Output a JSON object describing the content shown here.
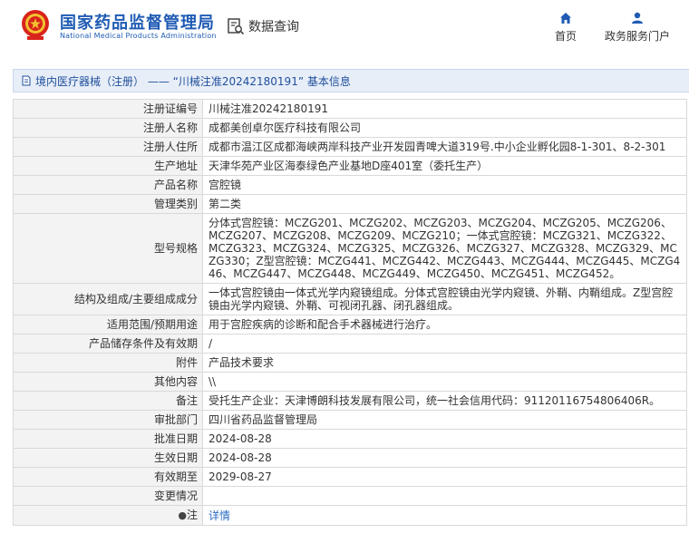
{
  "header": {
    "title_cn": "国家药品监督管理局",
    "title_en": "National Medical Products Administration",
    "query_label": "数据查询",
    "nav": {
      "home": "首页",
      "service": "政务服务门户"
    }
  },
  "breadcrumb": "境内医疗器械（注册） —— “川械注准20242180191” 基本信息",
  "details": [
    {
      "label": "注册证编号",
      "value": "川械注准20242180191"
    },
    {
      "label": "注册人名称",
      "value": "成都美创卓尔医疗科技有限公司"
    },
    {
      "label": "注册人住所",
      "value": "成都市温江区成都海峡两岸科技产业开发园青啤大道319号.中小企业孵化园8-1-301、8-2-301"
    },
    {
      "label": "生产地址",
      "value": "天津华苑产业区海泰绿色产业基地D座401室（委托生产）"
    },
    {
      "label": "产品名称",
      "value": "宫腔镜"
    },
    {
      "label": "管理类别",
      "value": "第二类"
    },
    {
      "label": "型号规格",
      "value": "分体式宫腔镜：MCZG201、MCZG202、MCZG203、MCZG204、MCZG205、MCZG206、MCZG207、MCZG208、MCZG209、MCZG210；一体式宫腔镜：MCZG321、MCZG322、MCZG323、MCZG324、MCZG325、MCZG326、MCZG327、MCZG328、MCZG329、MCZG330；Z型宫腔镜：MCZG441、MCZG442、MCZG443、MCZG444、MCZG445、MCZG446、MCZG447、MCZG448、MCZG449、MCZG450、MCZG451、MCZG452。"
    },
    {
      "label": "结构及组成/主要组成成分",
      "value": "一体式宫腔镜由一体式光学内窥镜组成。分体式宫腔镜由光学内窥镜、外鞘、内鞘组成。Z型宫腔镜由光学内窥镜、外鞘、可视闭孔器、闭孔器组成。"
    },
    {
      "label": "适用范围/预期用途",
      "value": "用于宫腔疾病的诊断和配合手术器械进行治疗。"
    },
    {
      "label": "产品储存条件及有效期",
      "value": "/"
    },
    {
      "label": "附件",
      "value": "产品技术要求"
    },
    {
      "label": "其他内容",
      "value": "\\\\"
    },
    {
      "label": "备注",
      "value": "受托生产企业：天津博朗科技发展有限公司，统一社会信用代码：91120116754806406R。"
    },
    {
      "label": "审批部门",
      "value": "四川省药品监督管理局"
    },
    {
      "label": "批准日期",
      "value": "2024-08-28"
    },
    {
      "label": "生效日期",
      "value": "2024-08-28"
    },
    {
      "label": "有效期至",
      "value": "2029-08-27"
    },
    {
      "label": "变更情况",
      "value": ""
    }
  ],
  "note": {
    "label": "注",
    "link": "详情"
  }
}
